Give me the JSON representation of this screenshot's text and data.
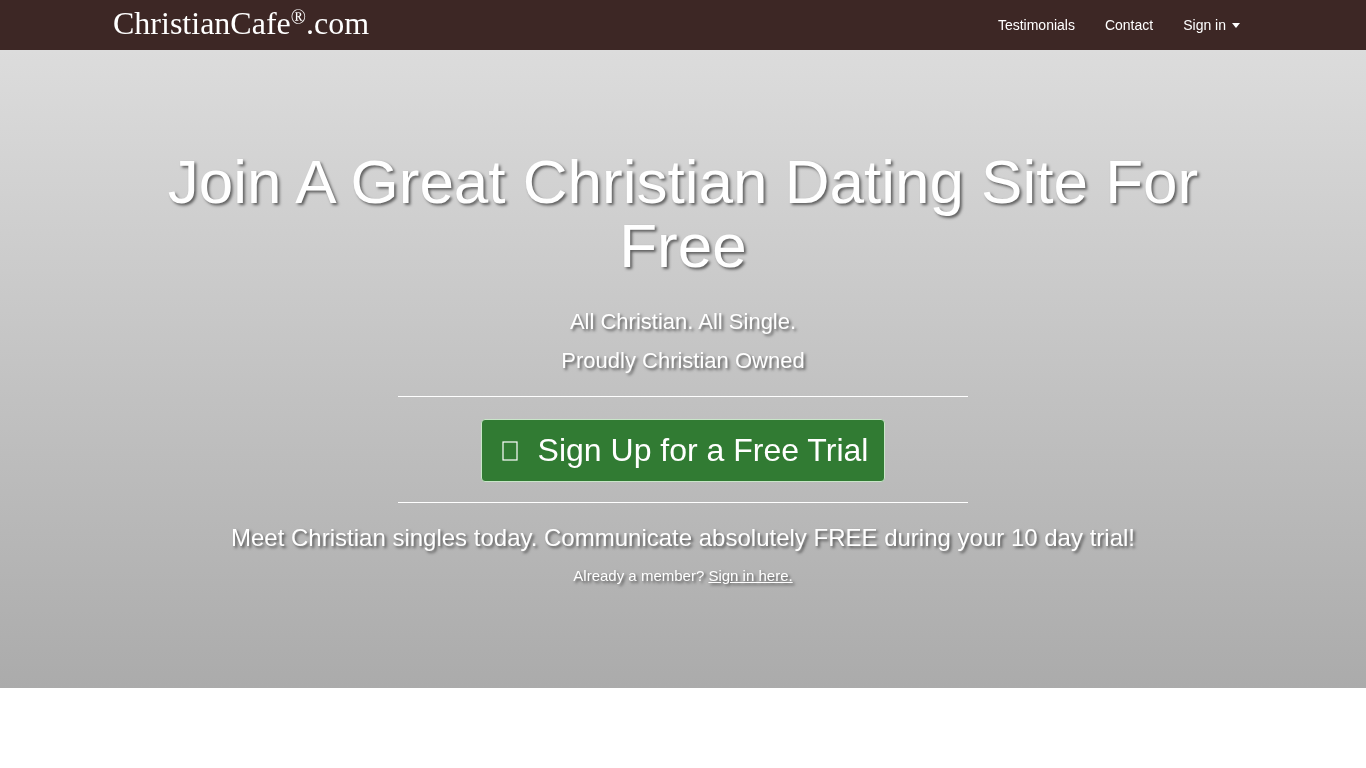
{
  "navbar": {
    "logo": "ChristianCafe$^{®}$.com",
    "links": [
      {
        "label": "Testimonials",
        "kind": "link"
      },
      {
        "label": "Contact",
        "kind": "link"
      },
      {
        "label": "Sign in",
        "kind": "dropdown"
      }
    ]
  },
  "hero": {
    "title": "Join A Great Christian Dating Site For Free",
    "subtitles": [
      "All Christian. All Single.",
      "Proudly Christian Owned"
    ],
    "cta": "Sign Up for a Free Trial",
    "tagline": "Meet Christian singles today. Communicate absolutely FREE during your 10 day trial!",
    "member_prompt": "Already a member?",
    "member_link": "Sign in here."
  }
}
